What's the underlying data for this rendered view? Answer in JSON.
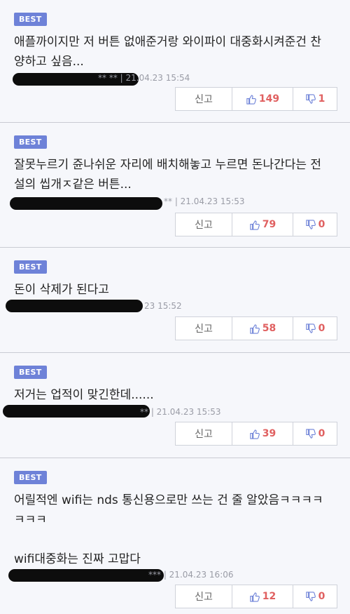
{
  "comments": [
    {
      "badge": "BEST",
      "text": "애플까이지만 저 버튼 없애준거랑 와이파이 대중화시켜준건 찬\n양하고 싶음...",
      "meta": "** ** | 21.04.23 15:54",
      "report": "신고",
      "likes": "149",
      "dislikes": "1"
    },
    {
      "badge": "BEST",
      "text": "잘못누르기 쥰나쉬운 자리에 배치해놓고 누르면 돈나간다는 전\n설의 씹개ㅈ같은 버튼...",
      "meta": "** | 21.04.23 15:53",
      "report": "신고",
      "likes": "79",
      "dislikes": "0"
    },
    {
      "badge": "BEST",
      "text": "돈이 삭제가 된다고",
      "meta": "23 15:52",
      "report": "신고",
      "likes": "58",
      "dislikes": "0"
    },
    {
      "badge": "BEST",
      "text": "저거는 업적이 맞긴한데......",
      "meta": "** | 21.04.23 15:53",
      "report": "신고",
      "likes": "39",
      "dislikes": "0"
    },
    {
      "badge": "BEST",
      "text": "어릴적엔 wifi는 nds 통신용으로만 쓰는 건 줄 알았음ㅋㅋㅋㅋ\nㅋㅋㅋ\n\nwifi대중화는 진짜 고맙다",
      "meta": "*** | 21.04.23 16:06",
      "report": "신고",
      "likes": "12",
      "dislikes": "0"
    }
  ]
}
